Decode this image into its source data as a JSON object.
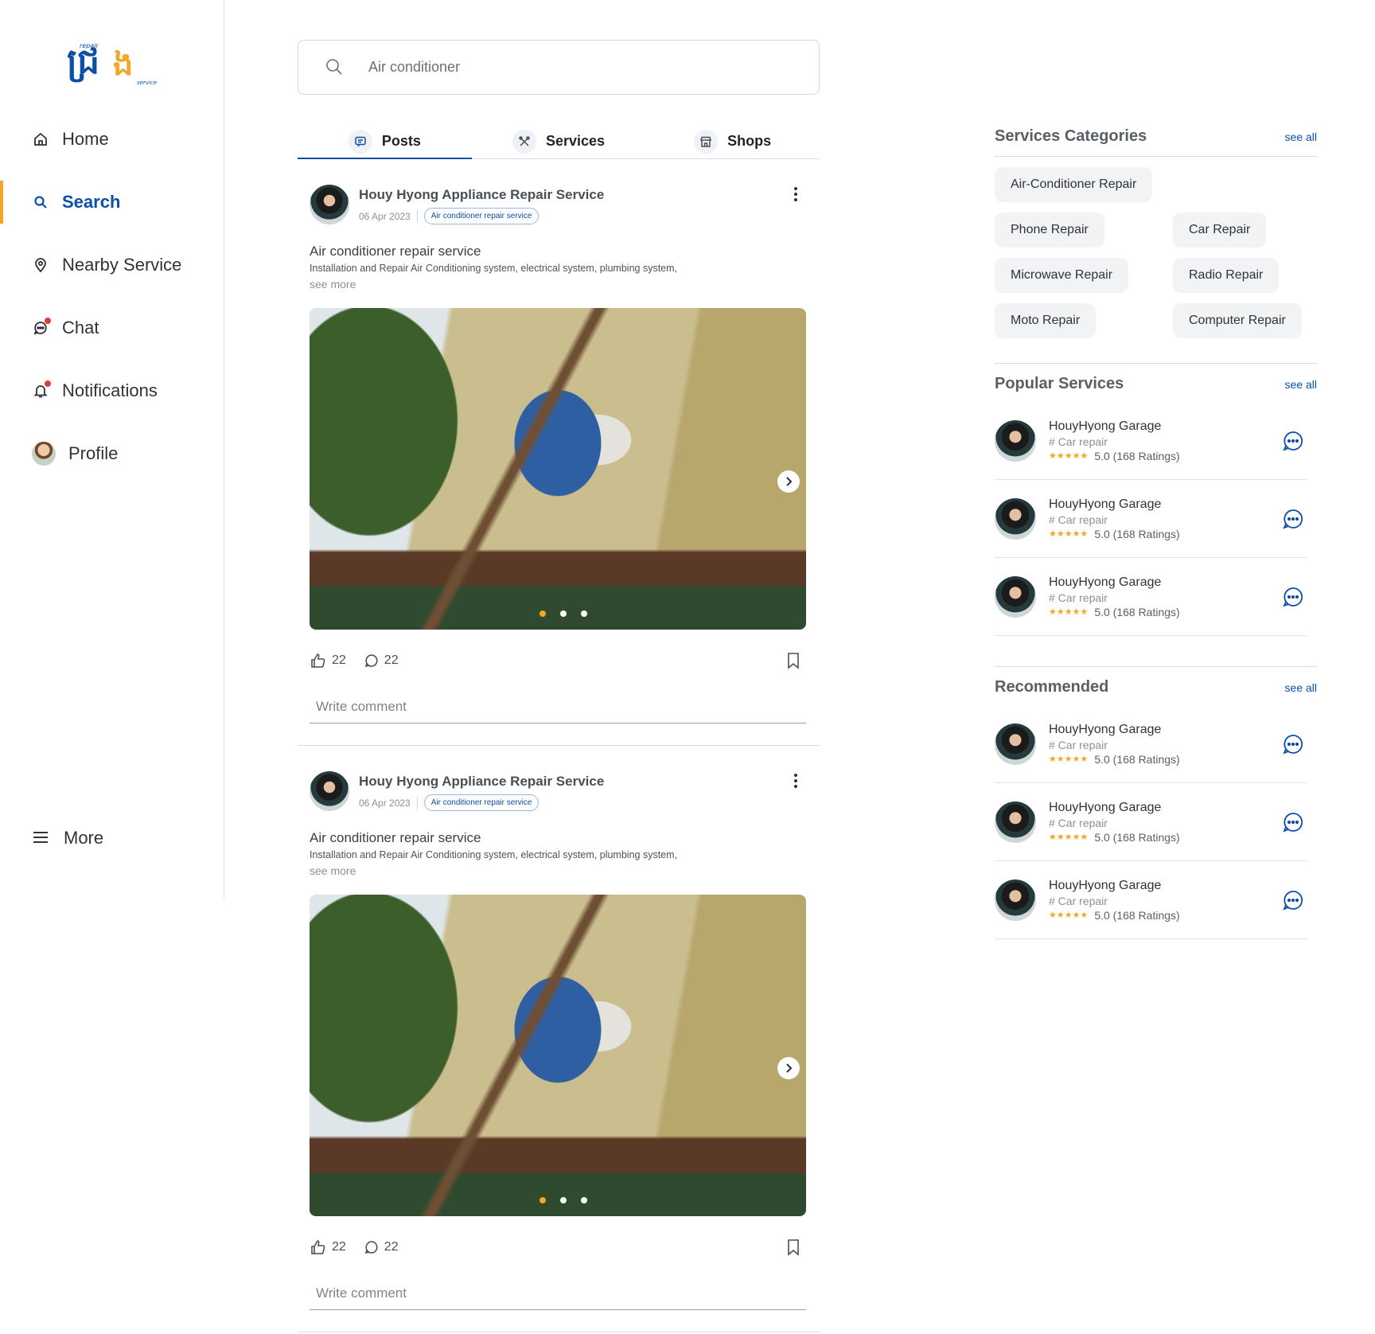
{
  "brand": {
    "logo_text_top": "repair",
    "logo_text_bottom": "service"
  },
  "nav": {
    "items": [
      {
        "label": "Home"
      },
      {
        "label": "Search"
      },
      {
        "label": "Nearby Service"
      },
      {
        "label": "Chat"
      },
      {
        "label": "Notifications"
      },
      {
        "label": "Profile"
      }
    ],
    "active": "Search",
    "more_label": "More"
  },
  "search": {
    "value": "Air conditioner"
  },
  "tabs": [
    {
      "label": "Posts"
    },
    {
      "label": "Services"
    },
    {
      "label": "Shops"
    }
  ],
  "active_tab": "Posts",
  "posts": [
    {
      "author": "Houy Hyong Appliance Repair Service",
      "date": "06 Apr 2023",
      "tag": "Air conditioner repair service",
      "title": "Air conditioner repair service",
      "description": "Installation and Repair Air Conditioning system, electrical system, plumbing system,",
      "see_more": "see more",
      "likes": "22",
      "comments": "22",
      "comment_placeholder": "Write comment"
    },
    {
      "author": "Houy Hyong Appliance Repair Service",
      "date": "06 Apr 2023",
      "tag": "Air conditioner repair service",
      "title": "Air conditioner repair service",
      "description": "Installation and Repair Air Conditioning system, electrical system, plumbing system,",
      "see_more": "see more",
      "likes": "22",
      "comments": "22",
      "comment_placeholder": "Write comment"
    }
  ],
  "categories": {
    "title": "Services Categories",
    "see_all": "see all",
    "items": [
      "Air-Conditioner Repair",
      "Phone Repair",
      "Car Repair",
      "Microwave Repair",
      "Radio Repair",
      "Moto Repair",
      "Computer Repair"
    ]
  },
  "popular": {
    "title": "Popular Services",
    "see_all": "see all",
    "items": [
      {
        "name": "HouyHyong Garage",
        "category": "# Car repair",
        "stars": "★★★★★",
        "rating": "5.0 (168 Ratings)"
      },
      {
        "name": "HouyHyong Garage",
        "category": "# Car repair",
        "stars": "★★★★★",
        "rating": "5.0 (168 Ratings)"
      },
      {
        "name": "HouyHyong Garage",
        "category": "# Car repair",
        "stars": "★★★★★",
        "rating": "5.0 (168 Ratings)"
      }
    ]
  },
  "recommended": {
    "title": "Recommended",
    "see_all": "see all",
    "items": [
      {
        "name": "HouyHyong Garage",
        "category": "# Car repair",
        "stars": "★★★★★",
        "rating": "5.0 (168 Ratings)"
      },
      {
        "name": "HouyHyong Garage",
        "category": "# Car repair",
        "stars": "★★★★★",
        "rating": "5.0 (168 Ratings)"
      },
      {
        "name": "HouyHyong Garage",
        "category": "# Car repair",
        "stars": "★★★★★",
        "rating": "5.0 (168 Ratings)"
      }
    ]
  },
  "colors": {
    "primary": "#0b4fa8",
    "accent": "#f5a623",
    "alert": "#e43a3a"
  },
  "icons": {
    "nav": [
      "home-icon",
      "search-icon",
      "location-pin-icon",
      "chat-icon",
      "bell-icon",
      "avatar"
    ],
    "tabs": [
      "post-icon",
      "tools-icon",
      "shop-icon"
    ],
    "actions": [
      "thumbs-up-icon",
      "comment-icon",
      "bookmark-icon",
      "chat-bubble-icon"
    ]
  }
}
